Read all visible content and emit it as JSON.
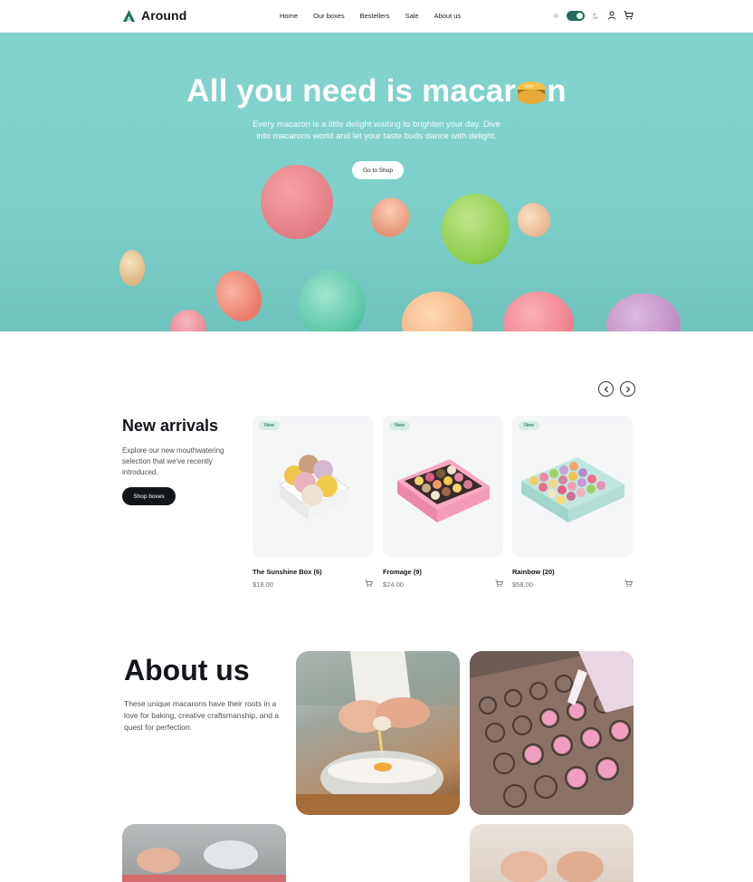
{
  "brand": {
    "name": "Around",
    "accent": "#1f6d5c"
  },
  "nav": [
    "Home",
    "Our boxes",
    "Bestellers",
    "Sale",
    "About us"
  ],
  "header_icons": [
    "sun-icon",
    "theme-toggle",
    "moon-icon",
    "user-icon",
    "cart-icon"
  ],
  "hero": {
    "title_part1": "All you need is macar",
    "title_part2": "n",
    "subtitle": "Every macaron is a little delight waiting to brighten your day. Dive into macarons world and let your taste buds dance with delight.",
    "button": "Go to Shop",
    "background": "#82d3cd"
  },
  "new_arrivals": {
    "title": "New arrivals",
    "description": "Explore our new mouthwatering selection that we've recently introduced.",
    "button": "Shop boxes",
    "products": [
      {
        "badge": "New",
        "name": "The Sunshine Box (6)",
        "price": "$18.00"
      },
      {
        "badge": "New",
        "name": "Fromage (9)",
        "price": "$24.00"
      },
      {
        "badge": "New",
        "name": "Rainbow (20)",
        "price": "$58.00"
      }
    ]
  },
  "about": {
    "title": "About us",
    "description": "These unique macarons have their roots in a love for baking, creative craftsmanship, and a quest for perfection."
  }
}
